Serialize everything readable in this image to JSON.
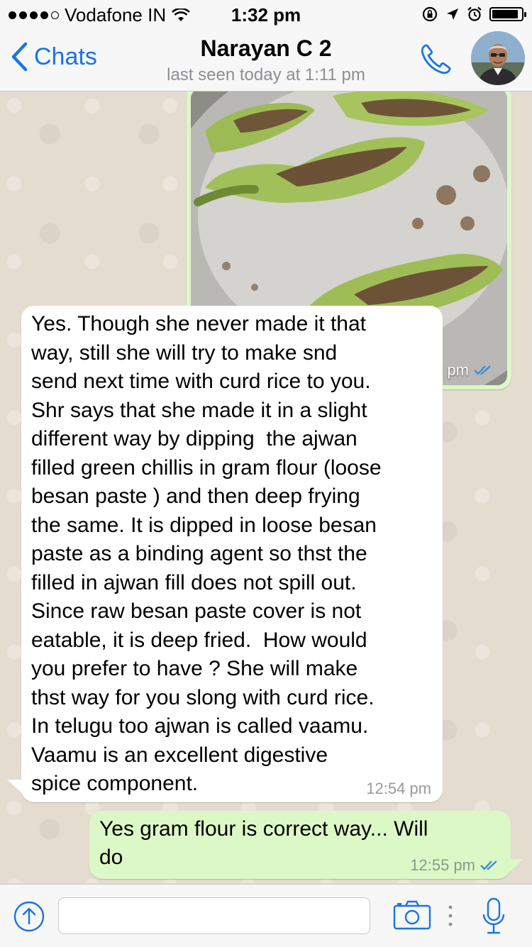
{
  "status_bar": {
    "carrier": "Vodafone IN",
    "time": "1:32 pm",
    "signal_dots_filled": 4,
    "signal_dots_total": 5
  },
  "nav": {
    "back_label": "Chats",
    "contact_name": "Narayan C 2",
    "last_seen": "last seen today at 1:11 pm",
    "accent_color": "#1a73e8"
  },
  "messages": [
    {
      "type": "image",
      "direction": "outgoing",
      "time": "12:43 pm",
      "status_icon": "double-check-icon"
    },
    {
      "type": "text",
      "direction": "incoming",
      "lines": [
        "Yes. Though she never made it that",
        "way, still she will try to make snd",
        "send next time with curd rice to you.",
        "Shr says that she made it in a slight",
        "different way by dipping  the ajwan",
        "filled green chillis in gram flour (loose",
        "besan paste ) and then deep frying",
        "the same. It is dipped in loose besan",
        "paste as a binding agent so thst the",
        "filled in ajwan fill does not spill out.",
        "Since raw besan paste cover is not",
        "eatable, it is deep fried.  How would",
        "you prefer to have ? She will make",
        "thst way for you slong with curd rice.",
        "In telugu too ajwan is called vaamu.",
        "Vaamu is an excellent digestive",
        "spice component."
      ],
      "time": "12:54 pm"
    },
    {
      "type": "text",
      "direction": "outgoing",
      "lines": [
        "Yes gram flour is correct way... Will",
        "do"
      ],
      "time": "12:55 pm",
      "status_icon": "double-check-icon"
    }
  ],
  "composer": {
    "placeholder": "",
    "value": ""
  },
  "colors": {
    "outgoing_bubble": "#dcf8c6",
    "incoming_bubble": "#ffffff",
    "chat_background": "#e4dccf",
    "read_ticks": "#3b8fd9"
  }
}
